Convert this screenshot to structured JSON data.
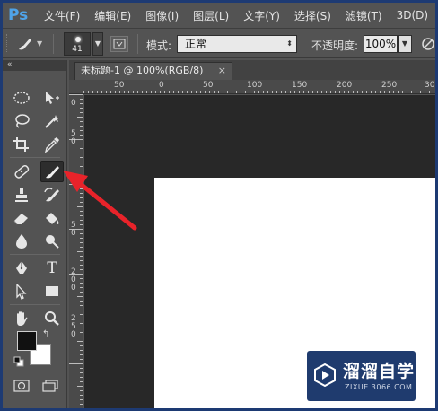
{
  "app": {
    "logo_text": "Ps"
  },
  "menu": [
    {
      "label": "文件(F)"
    },
    {
      "label": "编辑(E)"
    },
    {
      "label": "图像(I)"
    },
    {
      "label": "图层(L)"
    },
    {
      "label": "文字(Y)"
    },
    {
      "label": "选择(S)"
    },
    {
      "label": "滤镜(T)"
    },
    {
      "label": "3D(D)"
    }
  ],
  "options_bar": {
    "active_tool_icon": "brush-icon",
    "brush_size": "41",
    "mode_label": "模式:",
    "mode_value": "正常",
    "opacity_label": "不透明度:",
    "opacity_value": "100%"
  },
  "toolbox": {
    "collapse_glyph": "«",
    "tools": [
      {
        "name": "elliptical-marquee-tool",
        "icon": "ellipse-marquee-icon"
      },
      {
        "name": "move-tool",
        "icon": "move-icon"
      },
      {
        "name": "lasso-tool",
        "icon": "lasso-icon"
      },
      {
        "name": "magic-wand-tool",
        "icon": "magic-wand-icon"
      },
      {
        "name": "crop-tool",
        "icon": "crop-icon"
      },
      {
        "name": "eyedropper-tool",
        "icon": "eyedropper-icon"
      },
      {
        "name": "healing-brush-tool",
        "icon": "bandage-icon"
      },
      {
        "name": "brush-tool",
        "icon": "brush-icon",
        "active": true
      },
      {
        "name": "clone-stamp-tool",
        "icon": "stamp-icon"
      },
      {
        "name": "history-brush-tool",
        "icon": "history-brush-icon"
      },
      {
        "name": "eraser-tool",
        "icon": "eraser-icon"
      },
      {
        "name": "paint-bucket-tool",
        "icon": "bucket-icon"
      },
      {
        "name": "blur-tool",
        "icon": "blur-icon"
      },
      {
        "name": "dodge-tool",
        "icon": "dodge-icon"
      },
      {
        "name": "pen-tool",
        "icon": "pen-icon"
      },
      {
        "name": "type-tool",
        "icon": "type-icon",
        "glyph": "T"
      },
      {
        "name": "path-selection-tool",
        "icon": "arrow-icon"
      },
      {
        "name": "rectangle-tool",
        "icon": "rectangle-icon"
      },
      {
        "name": "hand-tool",
        "icon": "hand-icon"
      },
      {
        "name": "zoom-tool",
        "icon": "zoom-icon"
      }
    ],
    "foreground_color": "#111111",
    "background_color": "#ffffff"
  },
  "document": {
    "tab_title": "未标题-1 @ 100%(RGB/8)",
    "close_glyph": "×"
  },
  "rulers": {
    "top": [
      "50",
      "0",
      "50",
      "100",
      "150",
      "200",
      "250",
      "30"
    ],
    "left": [
      "0",
      "5",
      "0",
      "1",
      "5",
      "0",
      "2",
      "0",
      "0",
      "2",
      "5",
      "0"
    ]
  },
  "watermark": {
    "title": "溜溜自学",
    "subtitle": "ZIXUE.3066.COM"
  },
  "annotation": {
    "arrow_color": "#e8232a"
  }
}
